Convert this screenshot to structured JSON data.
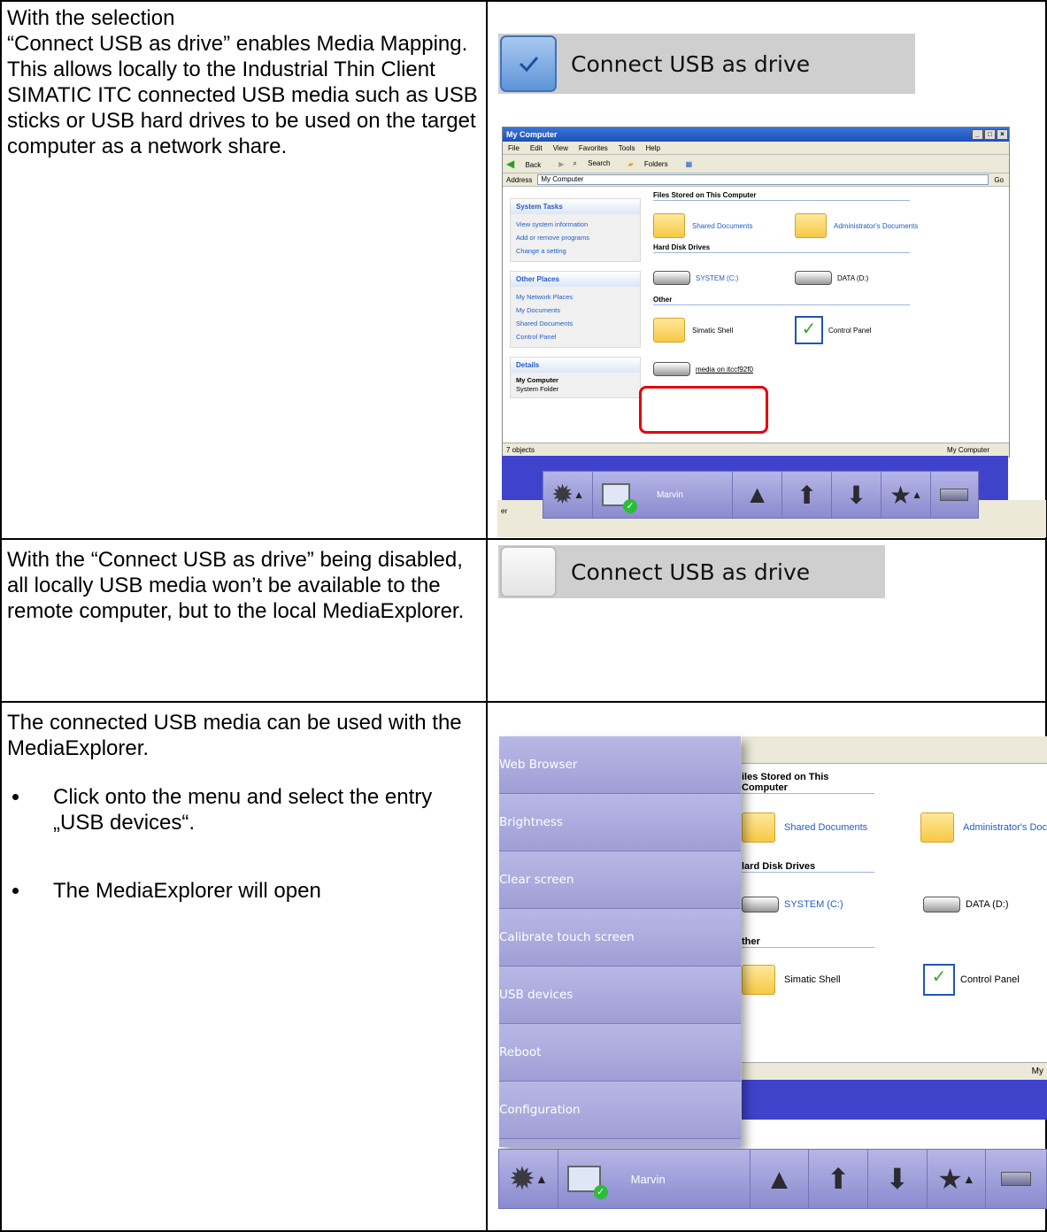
{
  "row1": {
    "text_lines": [
      "With the selection",
      "“Connect USB as drive” enables Media Mapping. This allows locally to the Industrial Thin Client SIMATIC ITC connected USB media such as USB sticks or USB hard drives to be used on the target computer as a network share."
    ],
    "checkbox_label": "Connect USB as drive",
    "checkbox_checked": true
  },
  "explorer": {
    "title": "My Computer",
    "menu": [
      "File",
      "Edit",
      "View",
      "Favorites",
      "Tools",
      "Help"
    ],
    "toolbar": [
      "Back",
      "Search",
      "Folders"
    ],
    "address_label": "Address",
    "address_value": "My Computer",
    "go": "Go",
    "system_tasks": {
      "title": "System Tasks",
      "items": [
        "View system information",
        "Add or remove programs",
        "Change a setting"
      ]
    },
    "other_places": {
      "title": "Other Places",
      "items": [
        "My Network Places",
        "My Documents",
        "Shared Documents",
        "Control Panel"
      ]
    },
    "details": {
      "title": "Details",
      "name": "My Computer",
      "type": "System Folder"
    },
    "groups": {
      "files": "Files Stored on This Computer",
      "hdd": "Hard Disk Drives",
      "other": "Other"
    },
    "items": {
      "shared": "Shared Documents",
      "admin": "Administrator's Documents",
      "sysc": "SYSTEM (C:)",
      "datad": "DATA (D:)",
      "shell": "Simatic Shell",
      "cpanel": "Control Panel",
      "media": "media on itccf92f0"
    },
    "status_left": "7 objects",
    "status_right": "My Computer",
    "taskbar_user": "Marvin",
    "edge_text": "er"
  },
  "row2": {
    "text": "With the “Connect USB as drive” being disabled, all locally USB media won’t be available to the remote computer, but to the local MediaExplorer.",
    "checkbox_label": "Connect USB as drive",
    "checkbox_checked": false
  },
  "row3": {
    "intro": "The connected USB media can be used with the MediaExplorer.",
    "bullets": [
      "Click onto the menu and select the entry „USB devices“.",
      "The MediaExplorer will open"
    ],
    "menu_items": [
      "Web Browser",
      "Brightness",
      "Clear screen",
      "Calibrate touch screen",
      "USB devices",
      "Reboot",
      "Configuration"
    ],
    "bg_groups": {
      "files": "iles Stored on This Computer",
      "hdd": "lard Disk Drives",
      "other": "ther"
    },
    "bg_items": {
      "shared": "Shared Documents",
      "admin": "Administrator's Doc",
      "sysc": "SYSTEM (C:)",
      "datad": "DATA (D:)",
      "shell": "Simatic Shell",
      "cpanel": "Control Panel"
    },
    "bg_status_right": "My",
    "taskbar_user": "Marvin"
  }
}
